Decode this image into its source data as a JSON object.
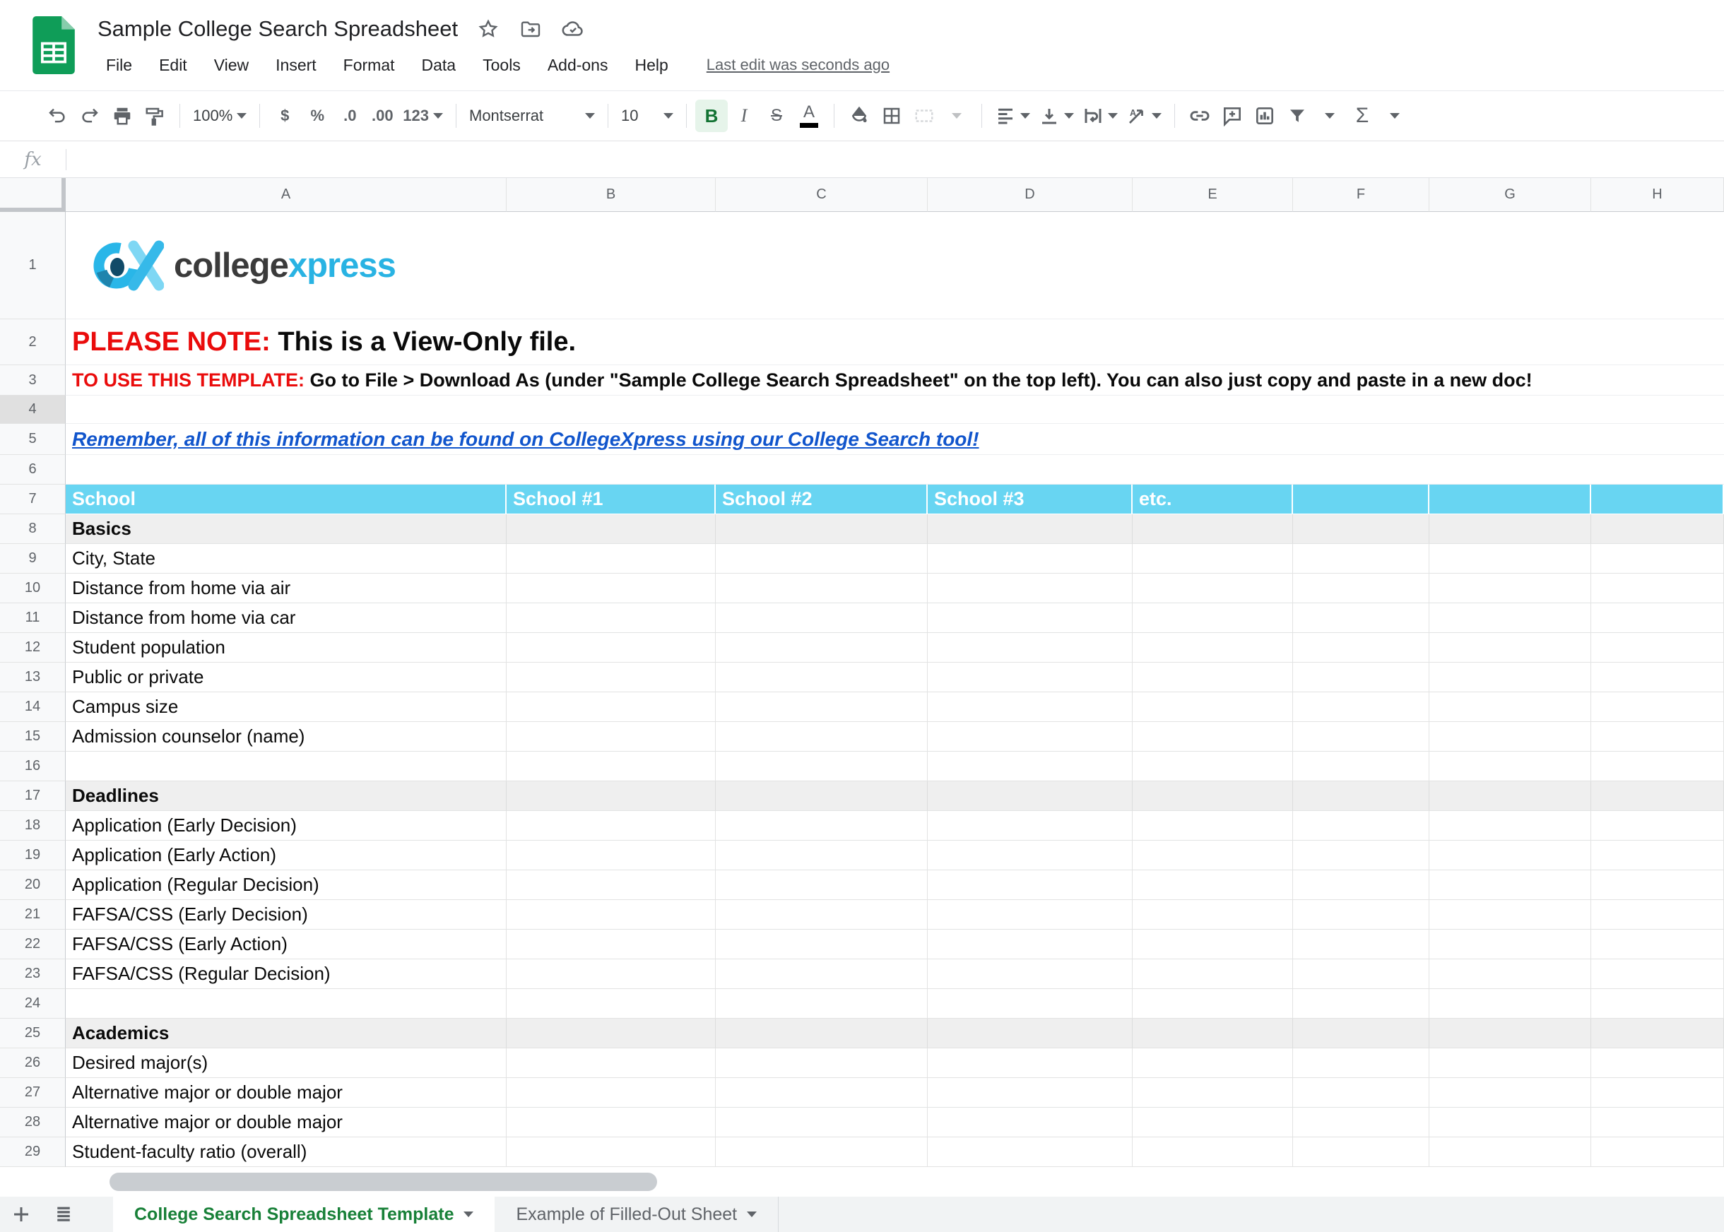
{
  "titlebar": {
    "title": "Sample College Search Spreadsheet",
    "menus": [
      "File",
      "Edit",
      "View",
      "Insert",
      "Format",
      "Data",
      "Tools",
      "Add-ons",
      "Help"
    ],
    "last_edit": "Last edit was seconds ago"
  },
  "toolbar": {
    "zoom": "100%",
    "currency": "$",
    "percent": "%",
    "decimal_decrease": ".0",
    "decimal_increase": ".00",
    "number_format": "123",
    "font_name": "Montserrat",
    "font_size": "10",
    "bold": "B",
    "italic": "I",
    "strikethrough": "S",
    "text_color": "A",
    "functions": "Σ"
  },
  "formula_bar": {
    "fx": "fx"
  },
  "columns": [
    "A",
    "B",
    "C",
    "D",
    "E",
    "F",
    "G",
    "H"
  ],
  "logo": {
    "text_dark": "college",
    "text_cyan": "xpress"
  },
  "sheet": {
    "rows": [
      {
        "n": 1,
        "type": "logo"
      },
      {
        "n": 2,
        "type": "note",
        "red": "PLEASE NOTE:",
        "black": "This is a View-Only file."
      },
      {
        "n": 3,
        "type": "note",
        "red": "TO USE THIS TEMPLATE:",
        "black": "Go to File > Download As (under \"Sample College Search Spreadsheet\" on the top left). You can also just copy and paste in a new doc!"
      },
      {
        "n": 4,
        "type": "blank"
      },
      {
        "n": 5,
        "type": "link",
        "text": "Remember, all of this information can be found on CollegeXpress using our College Search tool!"
      },
      {
        "n": 6,
        "type": "blank"
      },
      {
        "n": 7,
        "type": "header",
        "cells": [
          "School",
          "School #1",
          "School #2",
          "School #3",
          "etc.",
          "",
          "",
          ""
        ]
      },
      {
        "n": 8,
        "type": "section",
        "label": "Basics"
      },
      {
        "n": 9,
        "type": "item",
        "label": "City, State"
      },
      {
        "n": 10,
        "type": "item",
        "label": "Distance from home via air"
      },
      {
        "n": 11,
        "type": "item",
        "label": "Distance from home via car"
      },
      {
        "n": 12,
        "type": "item",
        "label": "Student population"
      },
      {
        "n": 13,
        "type": "item",
        "label": "Public or private"
      },
      {
        "n": 14,
        "type": "item",
        "label": "Campus size"
      },
      {
        "n": 15,
        "type": "item",
        "label": "Admission counselor (name)"
      },
      {
        "n": 16,
        "type": "item",
        "label": ""
      },
      {
        "n": 17,
        "type": "section",
        "label": "Deadlines"
      },
      {
        "n": 18,
        "type": "item",
        "label": "Application (Early Decision)"
      },
      {
        "n": 19,
        "type": "item",
        "label": "Application (Early Action)"
      },
      {
        "n": 20,
        "type": "item",
        "label": "Application (Regular Decision)"
      },
      {
        "n": 21,
        "type": "item",
        "label": "FAFSA/CSS (Early Decision)"
      },
      {
        "n": 22,
        "type": "item",
        "label": "FAFSA/CSS (Early Action)"
      },
      {
        "n": 23,
        "type": "item",
        "label": "FAFSA/CSS (Regular Decision)"
      },
      {
        "n": 24,
        "type": "item",
        "label": ""
      },
      {
        "n": 25,
        "type": "section",
        "label": "Academics"
      },
      {
        "n": 26,
        "type": "item",
        "label": "Desired major(s)"
      },
      {
        "n": 27,
        "type": "item",
        "label": "Alternative major or double major"
      },
      {
        "n": 28,
        "type": "item",
        "label": "Alternative major or double major"
      },
      {
        "n": 29,
        "type": "item",
        "label": "Student-faculty ratio (overall)"
      }
    ]
  },
  "tabs": {
    "active": "College Search Spreadsheet Template",
    "inactive": "Example of Filled-Out Sheet"
  },
  "colors": {
    "header_cyan": "#68d5f2",
    "section_gray": "#efefef",
    "note_red": "#ea0c0c",
    "link_blue": "#1155cc",
    "active_tab_green": "#188038",
    "sheets_green": "#0f9d58",
    "logo_cyan": "#29b3e3",
    "logo_dark": "#3b3b3b"
  }
}
